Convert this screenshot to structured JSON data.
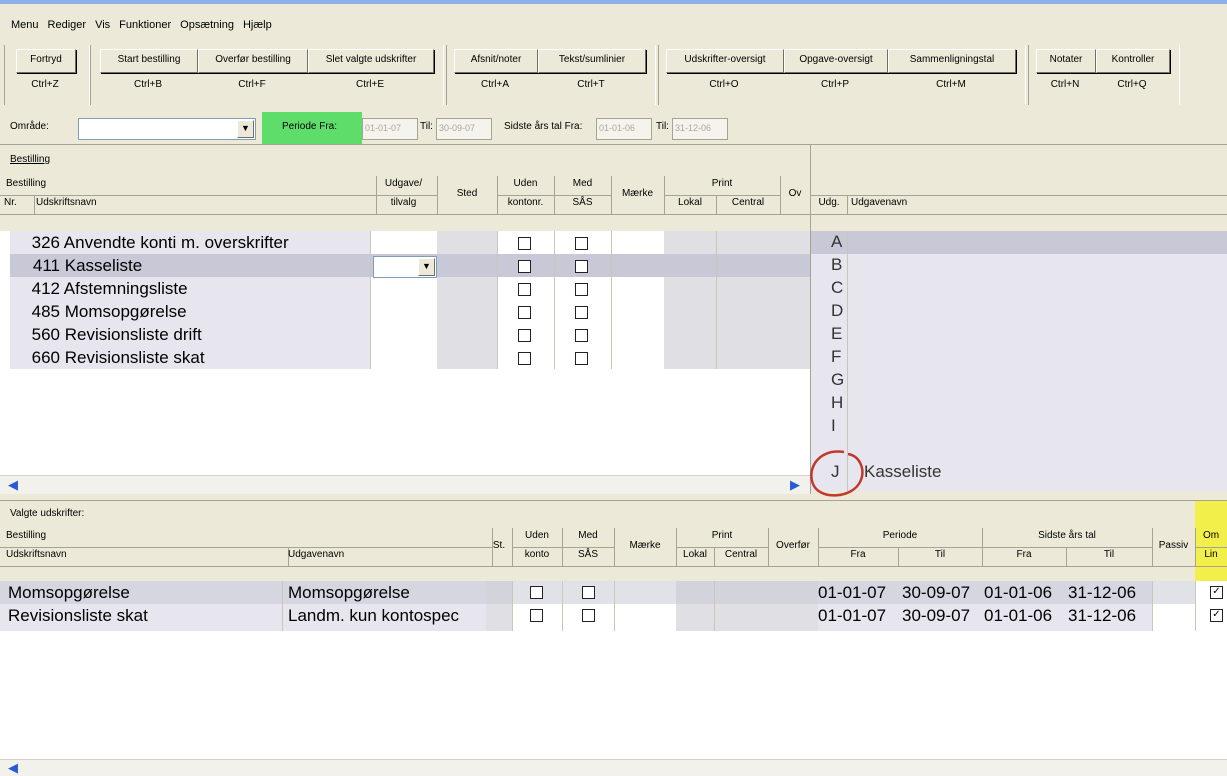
{
  "menu": [
    "Menu",
    "Rediger",
    "Vis",
    "Funktioner",
    "Opsætning",
    "Hjælp"
  ],
  "toolbar": {
    "buttons": [
      {
        "label": "Fortryd",
        "shortcut": "Ctrl+Z"
      },
      {
        "label": "Start bestilling",
        "shortcut": "Ctrl+B"
      },
      {
        "label": "Overfør bestilling",
        "shortcut": "Ctrl+F"
      },
      {
        "label": "Slet valgte udskrifter",
        "shortcut": "Ctrl+E"
      },
      {
        "label": "Afsnit/noter",
        "shortcut": "Ctrl+A"
      },
      {
        "label": "Tekst/sumlinier",
        "shortcut": "Ctrl+T"
      },
      {
        "label": "Udskrifter-oversigt",
        "shortcut": "Ctrl+O"
      },
      {
        "label": "Opgave-oversigt",
        "shortcut": "Ctrl+P"
      },
      {
        "label": "Sammenligningstal",
        "shortcut": "Ctrl+M"
      },
      {
        "label": "Notater",
        "shortcut": "Ctrl+N"
      },
      {
        "label": "Kontroller",
        "shortcut": "Ctrl+Q"
      }
    ]
  },
  "filter": {
    "omraade_label": "Område:",
    "omraade_value": "",
    "periode_fra_label": "Periode Fra:",
    "periode_fra": "01-01-07",
    "til_label": "Til:",
    "periode_til": "30-09-07",
    "sidste_label": "Sidste års tal Fra:",
    "sidste_fra": "01-01-06",
    "sidste_til_label": "Til:",
    "sidste_til": "31-12-06"
  },
  "upper": {
    "section_label": "Bestilling",
    "headers": {
      "bestilling": "Bestilling",
      "udgave": "Udgave/",
      "tilvalg": "tilvalg",
      "sted": "Sted",
      "uden": "Uden",
      "kontonr": "kontonr.",
      "med": "Med",
      "saas": "SÅS",
      "maerke": "Mærke",
      "print": "Print",
      "lokal": "Lokal",
      "central": "Central",
      "ov": "Ov",
      "nr": "Nr.",
      "udskriftsnavn": "Udskriftsnavn"
    },
    "rows": [
      {
        "nr": "326",
        "name": "Anvendte konti m. overskrifter"
      },
      {
        "nr": "411",
        "name": "Kasseliste"
      },
      {
        "nr": "412",
        "name": "Afstemningsliste"
      },
      {
        "nr": "485",
        "name": "Momsopgørelse"
      },
      {
        "nr": "560",
        "name": "Revisionsliste drift"
      },
      {
        "nr": "660",
        "name": "Revisionsliste skat"
      }
    ]
  },
  "right": {
    "headers": {
      "udg": "Udg.",
      "udgavenavn": "Udgavenavn"
    },
    "rows": [
      {
        "udg": "A",
        "name": ""
      },
      {
        "udg": "B",
        "name": ""
      },
      {
        "udg": "C",
        "name": ""
      },
      {
        "udg": "D",
        "name": ""
      },
      {
        "udg": "E",
        "name": ""
      },
      {
        "udg": "F",
        "name": ""
      },
      {
        "udg": "G",
        "name": ""
      },
      {
        "udg": "H",
        "name": ""
      },
      {
        "udg": "I",
        "name": ""
      },
      {
        "udg": "J",
        "name": "Kasseliste"
      }
    ]
  },
  "lower": {
    "section_label": "Valgte udskrifter:",
    "headers": {
      "bestilling": "Bestilling",
      "st": "St.",
      "uden": "Uden",
      "konto": "konto",
      "med": "Med",
      "saas": "SÅS",
      "maerke": "Mærke",
      "print": "Print",
      "lokal": "Lokal",
      "central": "Central",
      "overfoer": "Overfør",
      "periode": "Periode",
      "fra": "Fra",
      "til": "Til",
      "sidste": "Sidste års tal",
      "fra2": "Fra",
      "til2": "Til",
      "passiv": "Passiv",
      "om": "Om",
      "lin": "Lin",
      "udskriftsnavn": "Udskriftsnavn",
      "udgavenavn": "Udgavenavn"
    },
    "rows": [
      {
        "name": "Momsopgørelse",
        "udgave": "Momsopgørelse",
        "p_fra": "01-01-07",
        "p_til": "30-09-07",
        "s_fra": "01-01-06",
        "s_til": "31-12-06"
      },
      {
        "name": "Revisionsliste skat",
        "udgave": "Landm. kun kontospec",
        "p_fra": "01-01-07",
        "p_til": "30-09-07",
        "s_fra": "01-01-06",
        "s_til": "31-12-06"
      }
    ]
  },
  "colors": {
    "green_highlight": "#5fdd6a",
    "yellow_highlight": "#f2ef4a",
    "selection": "#c9c8d6",
    "annotation_circle": "#c0392b"
  }
}
